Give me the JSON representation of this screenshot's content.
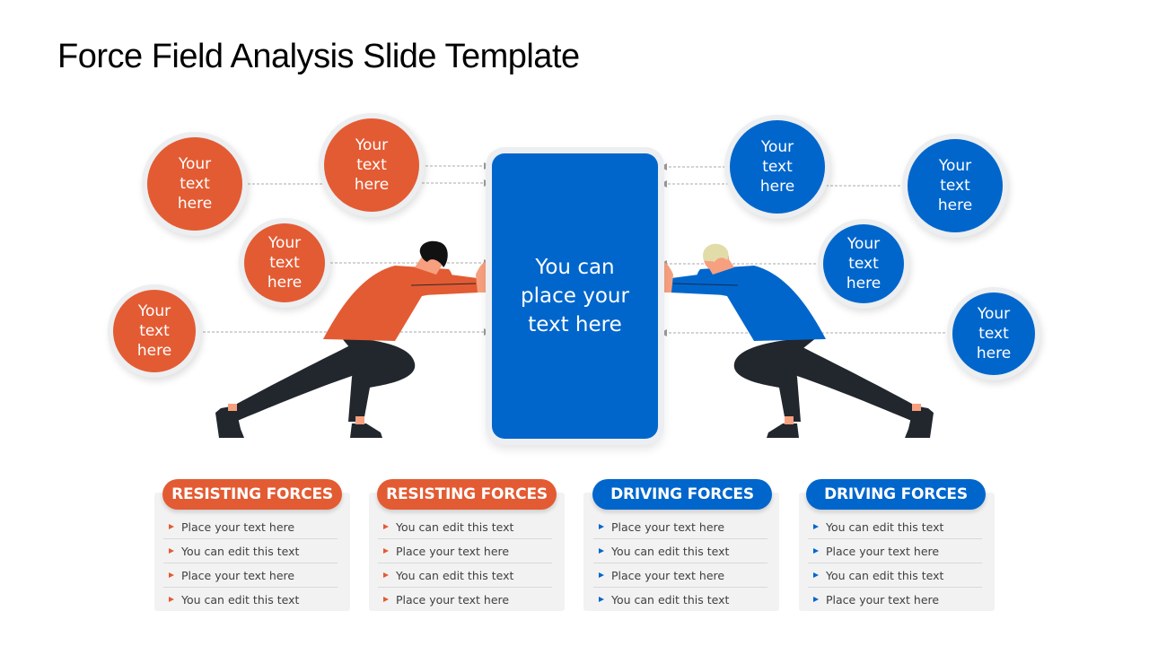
{
  "title": "Force Field Analysis Slide Template",
  "colors": {
    "resisting": "#e35b33",
    "driving": "#0066cc",
    "panel_bg": "#f2f2f2",
    "trousers": "#22262d",
    "skin": "#f6a07f"
  },
  "center": {
    "text": "You can place your text here"
  },
  "resisting_circles": [
    {
      "text": "Your text here"
    },
    {
      "text": "Your text here"
    },
    {
      "text": "Your text here"
    },
    {
      "text": "Your text here"
    }
  ],
  "driving_circles": [
    {
      "text": "Your text here"
    },
    {
      "text": "Your text here"
    },
    {
      "text": "Your text here"
    },
    {
      "text": "Your text here"
    }
  ],
  "figures": {
    "left": "person-pushing-orange-shirt",
    "right": "person-pushing-blue-shirt"
  },
  "panels": [
    {
      "type": "resisting",
      "heading": "RESISTING FORCES",
      "items": [
        "Place your text here",
        "You can edit this text",
        "Place your text here",
        "You can edit this text"
      ]
    },
    {
      "type": "resisting",
      "heading": "RESISTING FORCES",
      "items": [
        "You can edit this text",
        "Place your text here",
        "You can edit this text",
        "Place your text here"
      ]
    },
    {
      "type": "driving",
      "heading": "DRIVING FORCES",
      "items": [
        "Place your text here",
        "You can edit this text",
        "Place your text here",
        "You can edit this text"
      ]
    },
    {
      "type": "driving",
      "heading": "DRIVING FORCES",
      "items": [
        "You can edit this text",
        "Place your text here",
        "You can edit this text",
        "Place your text here"
      ]
    }
  ]
}
